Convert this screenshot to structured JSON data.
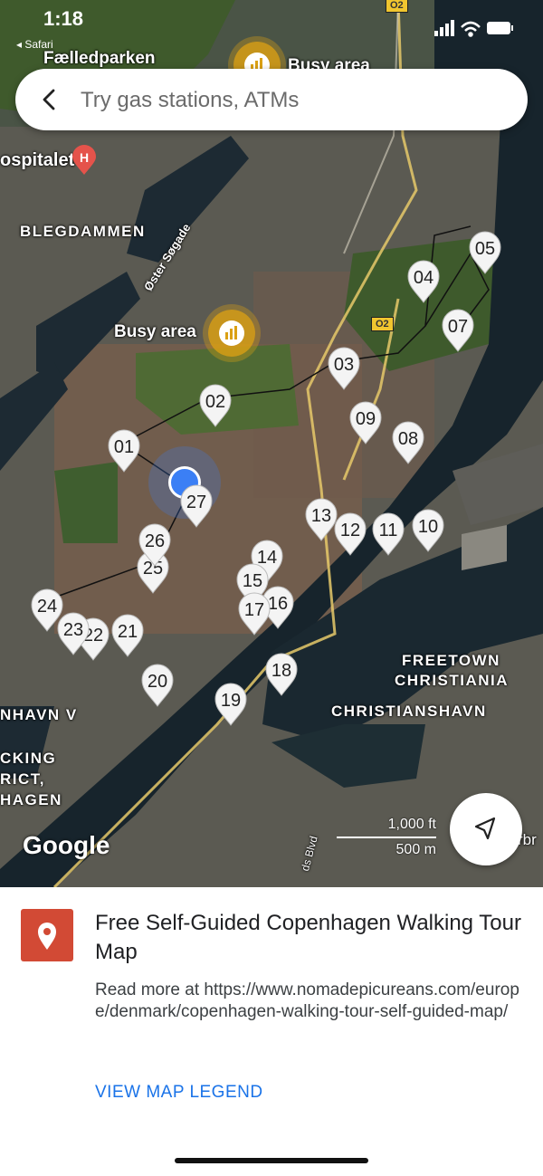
{
  "status_bar": {
    "time": "1:18",
    "back_app": "◂ Safari"
  },
  "search": {
    "placeholder": "Try gas stations, ATMs"
  },
  "map_labels": {
    "faelledparken": "Fælledparken",
    "hospitalet": "ospitalet",
    "blegdammen": "BLEGDAMMEN",
    "oster_sogade": "Øster Søgade",
    "freetown1": "FREETOWN",
    "freetown2": "CHRISTIANIA",
    "christianshavn": "CHRISTIANSHAVN",
    "nhavn": "NHAVN V",
    "cking": "CKING",
    "rict": "RICT,",
    "hagen": "HAGEN",
    "o2_top": "O2",
    "o2_mid": "O2",
    "arbr": "rbr",
    "blvd": "ds Blvd"
  },
  "busy_areas": [
    {
      "label": "Busy area"
    },
    {
      "label": "Busy area"
    }
  ],
  "markers": [
    "01",
    "02",
    "03",
    "04",
    "05",
    "07",
    "08",
    "09",
    "10",
    "11",
    "12",
    "13",
    "14",
    "15",
    "16",
    "17",
    "18",
    "19",
    "20",
    "21",
    "22",
    "23",
    "24",
    "25",
    "26",
    "27"
  ],
  "attribution": "Google",
  "scale": {
    "feet": "1,000 ft",
    "meters": "500 m"
  },
  "sheet": {
    "title": "Free Self-Guided Copenhagen Walking Tour Map",
    "description": "Read more at https://www.nomadepicureans.com/europe/denmark/copenhagen-walking-tour-self-guided-map/",
    "legend_link": "VIEW MAP LEGEND"
  },
  "colors": {
    "accent": "#1a73e8",
    "pin": "#d24a35",
    "busy": "#daa014",
    "user_dot": "#3b7ff5"
  }
}
